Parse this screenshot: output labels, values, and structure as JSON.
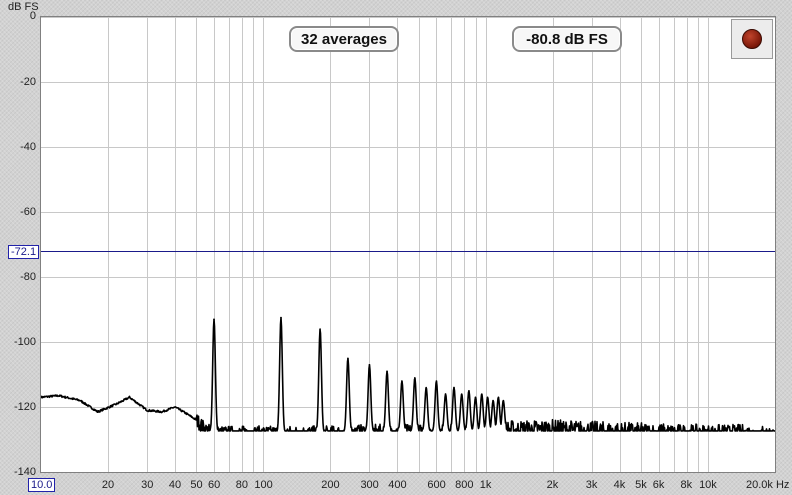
{
  "y_axis": {
    "unit": "dB FS",
    "ticks": [
      "0",
      "-20",
      "-40",
      "-60",
      "-80",
      "-100",
      "-120",
      "-140"
    ],
    "tick_values": [
      0,
      -20,
      -40,
      -60,
      -80,
      -100,
      -120,
      -140
    ],
    "range": [
      -140,
      0
    ]
  },
  "x_axis": {
    "scale": "log",
    "range": [
      10,
      20000
    ],
    "ticks": [
      "20",
      "30",
      "40",
      "50",
      "60",
      "80",
      "100",
      "200",
      "300",
      "400",
      "600",
      "800",
      "1k",
      "2k",
      "3k",
      "4k",
      "5k",
      "6k",
      "8k",
      "10k",
      "20.0k Hz"
    ],
    "tick_values": [
      20,
      30,
      40,
      50,
      60,
      80,
      100,
      200,
      300,
      400,
      600,
      800,
      1000,
      2000,
      3000,
      4000,
      5000,
      6000,
      8000,
      10000,
      20000
    ],
    "start_label": "10.0"
  },
  "overlay": {
    "averages": "32 averages",
    "level": "-80.8 dB FS"
  },
  "cursor": {
    "value": -72.1,
    "label": "-72.1",
    "color": "#1a1a8a"
  },
  "colors": {
    "grid": "#c8c8c8",
    "trace": "#000000",
    "cursor_line": "#1a1a8a",
    "record_button": "#8b1a0a"
  },
  "record_button_icon": "record-icon",
  "chart_data": {
    "type": "line",
    "xscale": "log",
    "xlim": [
      10,
      20000
    ],
    "ylim": [
      -140,
      0
    ],
    "grid": true,
    "noise_floor": [
      [
        10,
        -117
      ],
      [
        12,
        -116.5
      ],
      [
        15,
        -118
      ],
      [
        18,
        -121.5
      ],
      [
        22,
        -119
      ],
      [
        25,
        -117
      ],
      [
        30,
        -121
      ],
      [
        35,
        -121.5
      ],
      [
        40,
        -120
      ],
      [
        45,
        -122
      ],
      [
        50,
        -124
      ],
      [
        55,
        -127
      ],
      [
        60,
        -128
      ],
      [
        80,
        -128
      ],
      [
        100,
        -128
      ],
      [
        150,
        -128
      ],
      [
        200,
        -128
      ],
      [
        300,
        -127.5
      ],
      [
        500,
        -127.5
      ],
      [
        1000,
        -127.5
      ],
      [
        2000,
        -127
      ],
      [
        3000,
        -127.5
      ],
      [
        5000,
        -128
      ],
      [
        8000,
        -128.5
      ],
      [
        10000,
        -128.5
      ],
      [
        15000,
        -128.5
      ],
      [
        20000,
        -129
      ]
    ],
    "peaks": [
      {
        "freq": 60,
        "level": -93
      },
      {
        "freq": 120,
        "level": -92.5
      },
      {
        "freq": 180,
        "level": -96
      },
      {
        "freq": 240,
        "level": -105
      },
      {
        "freq": 300,
        "level": -107
      },
      {
        "freq": 360,
        "level": -109
      },
      {
        "freq": 420,
        "level": -112
      },
      {
        "freq": 480,
        "level": -111
      },
      {
        "freq": 540,
        "level": -114
      },
      {
        "freq": 600,
        "level": -112
      },
      {
        "freq": 660,
        "level": -116
      },
      {
        "freq": 720,
        "level": -114
      },
      {
        "freq": 780,
        "level": -116
      },
      {
        "freq": 840,
        "level": -115
      },
      {
        "freq": 900,
        "level": -117
      },
      {
        "freq": 960,
        "level": -116
      },
      {
        "freq": 1020,
        "level": -117
      },
      {
        "freq": 1080,
        "level": -118
      },
      {
        "freq": 1140,
        "level": -117
      },
      {
        "freq": 1200,
        "level": -118
      }
    ]
  }
}
